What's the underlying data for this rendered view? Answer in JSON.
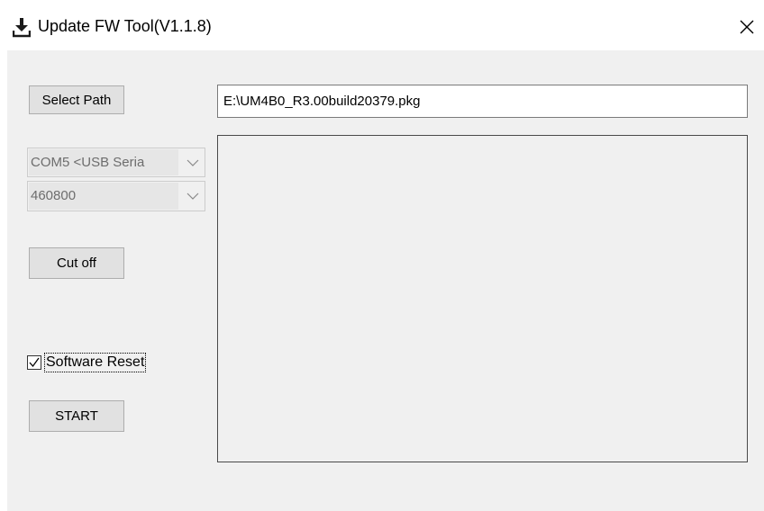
{
  "window": {
    "title": "Update FW Tool(V1.1.8)",
    "title_icon": "download-icon",
    "close_icon": "close-icon"
  },
  "controls": {
    "select_path_label": "Select Path",
    "path_value": "E:\\UM4B0_R3.00build20379.pkg",
    "port_combo_value": "COM5 <USB Seria",
    "baud_combo_value": "460800",
    "cut_off_label": "Cut off",
    "software_reset_label": "Software Reset",
    "software_reset_checked": true,
    "start_label": "START"
  },
  "colors": {
    "client_bg": "#f0f0f0",
    "button_bg": "#e1e1e1",
    "button_border": "#adadad",
    "disabled_text": "#6d6d6d"
  }
}
